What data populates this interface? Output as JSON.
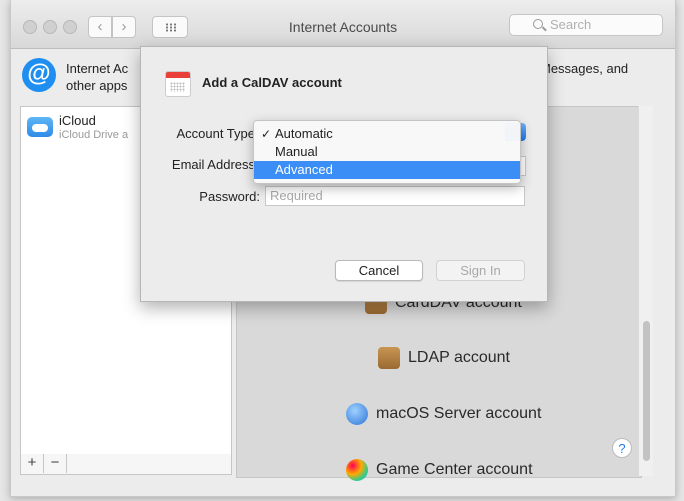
{
  "window": {
    "title": "Internet Accounts",
    "search_placeholder": "Search",
    "nav_back": "‹",
    "nav_forward": "›"
  },
  "header": {
    "icon_glyph": "@",
    "description_left": "Internet Ac\nother apps",
    "description_right": "Messages, and"
  },
  "sidebar": {
    "accounts": [
      {
        "name": "iCloud",
        "detail": "iCloud Drive a"
      }
    ],
    "add_label": "+",
    "remove_label": "−"
  },
  "providers": [
    {
      "label": "CardDAV account",
      "icon": "address-book-icon"
    },
    {
      "label": "LDAP account",
      "icon": "address-book-icon"
    },
    {
      "label": "macOS Server account",
      "icon": "globe-icon"
    },
    {
      "label": "Game Center account",
      "icon": "game-center-icon"
    }
  ],
  "help_label": "?",
  "dialog": {
    "title": "Add a CalDAV account",
    "account_type_label": "Account Type",
    "email_label": "Email Address",
    "password_label": "Password:",
    "password_placeholder": "Required",
    "cancel_label": "Cancel",
    "signin_label": "Sign In"
  },
  "account_type_menu": {
    "options": [
      "Automatic",
      "Manual",
      "Advanced"
    ],
    "checked": "Automatic",
    "highlighted": "Advanced",
    "check_glyph": "✓"
  },
  "colors": {
    "accent": "#3a8ef6",
    "calendar_red": "#e9403a"
  }
}
